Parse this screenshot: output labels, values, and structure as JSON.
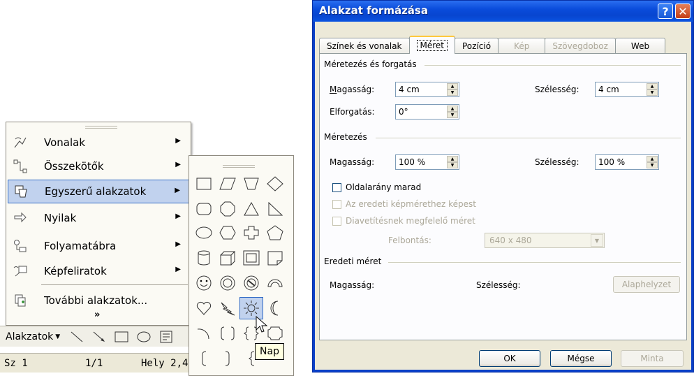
{
  "shapes_menu": {
    "items": [
      {
        "label": "Vonalak",
        "icon": "lines-icon"
      },
      {
        "label": "Összekötők",
        "icon": "connectors-icon"
      },
      {
        "label": "Egyszerű alakzatok",
        "icon": "basic-shapes-icon"
      },
      {
        "label": "Nyilak",
        "icon": "block-arrows-icon"
      },
      {
        "label": "Folyamatábra",
        "icon": "flowchart-icon"
      },
      {
        "label": "Képfeliratok",
        "icon": "callouts-icon"
      },
      {
        "label": "További alakzatok...",
        "icon": "more-shapes-icon"
      }
    ],
    "selected_index": 2
  },
  "submenu": {
    "hovered_shape": "sun",
    "tooltip": "Nap"
  },
  "toolbar": {
    "alakzatok_label": "Alakzatok"
  },
  "statusbar": {
    "section": "Sz 1",
    "page": "1/1",
    "position": "Hely 2,4"
  },
  "dialog": {
    "title": "Alakzat formázása",
    "tabs": [
      {
        "label": "Színek és vonalak",
        "state": "normal"
      },
      {
        "label": "Méret",
        "state": "active"
      },
      {
        "label": "Pozíció",
        "state": "normal"
      },
      {
        "label": "Kép",
        "state": "disabled"
      },
      {
        "label": "Szövegdoboz",
        "state": "disabled"
      },
      {
        "label": "Web",
        "state": "normal"
      }
    ],
    "size_rotate": {
      "group_label": "Méretezés és forgatás",
      "height_label": "Magasság:",
      "height_value": "4 cm",
      "width_label": "Szélesség:",
      "width_value": "4 cm",
      "rotation_label": "Elforgatás:",
      "rotation_value": "0°"
    },
    "scale": {
      "group_label": "Méretezés",
      "height_label": "Magasság:",
      "height_value": "100 %",
      "width_label": "Szélesség:",
      "width_value": "100 %",
      "lock_aspect": "Oldalarány marad",
      "relative_original": "Az eredeti képmérethez képest",
      "best_for_slideshow": "Diavetítésnek megfelelő méret",
      "resolution_label": "Felbontás:",
      "resolution_value": "640 x 480"
    },
    "original": {
      "group_label": "Eredeti méret",
      "height_label": "Magasság:",
      "width_label": "Szélesség:",
      "reset_label": "Alaphelyzet"
    },
    "buttons": {
      "ok": "OK",
      "cancel": "Mégse",
      "preview": "Minta"
    }
  }
}
